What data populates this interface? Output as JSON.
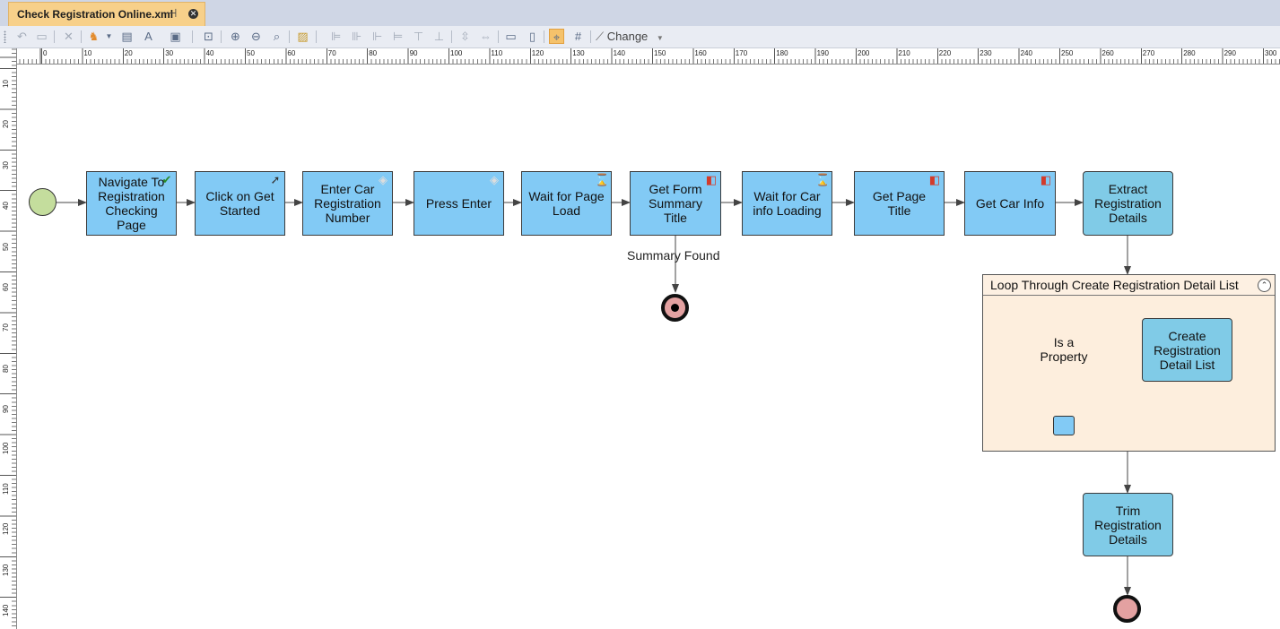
{
  "tab": {
    "title": "Check Registration Online.xml",
    "pin_icon": "pin-icon",
    "close_icon": "close-icon"
  },
  "toolbar": {
    "change_label": "Change"
  },
  "ruler": {
    "h_labels": [
      "0",
      "10",
      "20",
      "30",
      "40",
      "50",
      "60",
      "70",
      "80",
      "90",
      "100",
      "110",
      "120",
      "130",
      "140",
      "150",
      "160",
      "170",
      "180",
      "190",
      "200",
      "210",
      "220",
      "230",
      "240",
      "250",
      "260",
      "270",
      "280",
      "290",
      "300"
    ],
    "v_labels": [
      "10",
      "20",
      "30",
      "40",
      "50",
      "60",
      "70",
      "80",
      "90",
      "100",
      "110",
      "120",
      "130",
      "140"
    ]
  },
  "flow": {
    "nodes": {
      "navigate": {
        "label": "Navigate To Registration Checking Page",
        "icon": "page-check-icon"
      },
      "click_get_started": {
        "label": "Click on Get Started",
        "icon": "cursor-click-icon"
      },
      "enter_car_reg": {
        "label": "Enter Car Registration Number",
        "icon": "keyboard-icon"
      },
      "press_enter": {
        "label": "Press Enter",
        "icon": "keyboard-icon"
      },
      "wait_page_load": {
        "label": "Wait for Page Load",
        "icon": "hourglass-icon"
      },
      "get_form_summary": {
        "label": "Get Form Summary Title",
        "icon": "get-data-icon"
      },
      "wait_car_info": {
        "label": "Wait for Car info Loading",
        "icon": "hourglass-icon"
      },
      "get_page_title": {
        "label": "Get Page Title",
        "icon": "get-data-icon"
      },
      "get_car_info": {
        "label": "Get Car Info",
        "icon": "get-data-icon"
      },
      "extract_details": {
        "label": "Extract Registration Details"
      },
      "trim_details": {
        "label": "Trim Registration Details"
      }
    },
    "summary_edge_label": "Summary Found",
    "loop": {
      "title": "Loop Through Create Registration Detail List",
      "decision_label": "Is a Property",
      "create_label": "Create Registration Detail List"
    }
  },
  "colors": {
    "activity": "#82caf5",
    "rounded_activity": "#80cbe7",
    "start": "#c4dd9d",
    "end": "#e3a1a1",
    "decision": "#f0a060",
    "loop_bg": "#fdeedd",
    "active_tool": "#f5c26b"
  }
}
